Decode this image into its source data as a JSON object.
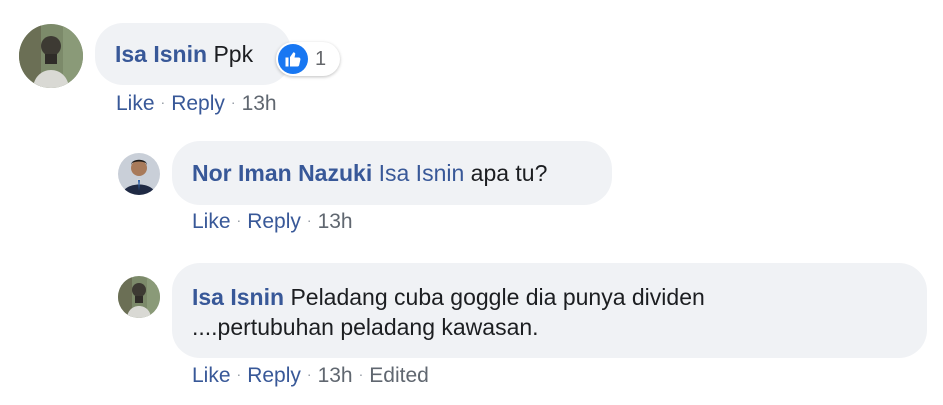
{
  "comments": [
    {
      "author": "Isa Isnin",
      "mention": "",
      "text": "Ppk",
      "reaction": {
        "icon": "like-icon",
        "count": "1",
        "color": "#1877f2"
      },
      "actions": {
        "like": "Like",
        "reply": "Reply",
        "time": "13h",
        "edited": ""
      }
    },
    {
      "author": "Nor Iman Nazuki",
      "mention": "Isa Isnin",
      "text": "apa tu?",
      "actions": {
        "like": "Like",
        "reply": "Reply",
        "time": "13h",
        "edited": ""
      }
    },
    {
      "author": "Isa Isnin",
      "mention": "",
      "text_line1": "Peladang cuba goggle dia punya dividen",
      "text_line2": "....pertubuhan peladang kawasan.",
      "actions": {
        "like": "Like",
        "reply": "Reply",
        "time": "13h",
        "edited": "Edited"
      }
    }
  ],
  "colors": {
    "link": "#385898",
    "bubble": "#f0f2f5",
    "like_blue": "#1877f2"
  }
}
